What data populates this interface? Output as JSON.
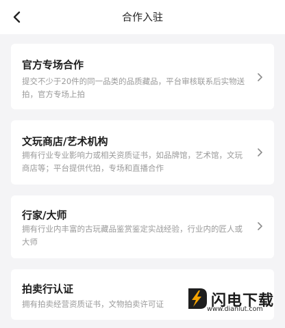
{
  "header": {
    "title": "合作入驻"
  },
  "cards": [
    {
      "title": "官方专场合作",
      "desc": "提交不少于20件的同一品类的品质藏品，平台审核联系后实物送拍，官方专场上拍"
    },
    {
      "title": "文玩商店/艺术机构",
      "desc": "拥有行业专业影响力或相关资质证书，如品牌馆，艺术馆，文玩商店等；平台提供代拍，专场和直播合作"
    },
    {
      "title": "行家/大师",
      "desc": "拥有行业内丰富的古玩藏品鉴赏鉴定实战经验，行业内的匠人或大师"
    },
    {
      "title": "拍卖行认证",
      "desc": "拥有拍卖经营资质证书，文物拍卖许可证"
    }
  ],
  "watermark": {
    "name": "闪电下载",
    "url": "www.dianlut.com"
  },
  "colors": {
    "background": "#f4f4f6",
    "card": "#ffffff",
    "logo_accent": "#f5a300"
  }
}
